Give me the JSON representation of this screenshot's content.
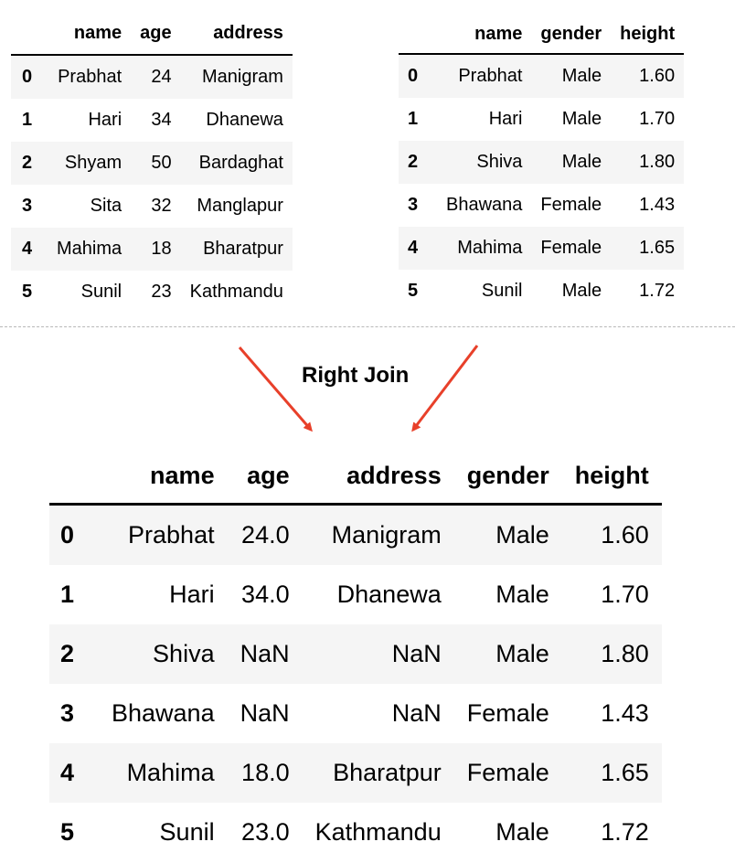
{
  "left_table": {
    "columns": [
      "",
      "name",
      "age",
      "address"
    ],
    "rows": [
      [
        "0",
        "Prabhat",
        "24",
        "Manigram"
      ],
      [
        "1",
        "Hari",
        "34",
        "Dhanewa"
      ],
      [
        "2",
        "Shyam",
        "50",
        "Bardaghat"
      ],
      [
        "3",
        "Sita",
        "32",
        "Manglapur"
      ],
      [
        "4",
        "Mahima",
        "18",
        "Bharatpur"
      ],
      [
        "5",
        "Sunil",
        "23",
        "Kathmandu"
      ]
    ]
  },
  "right_table": {
    "columns": [
      "",
      "name",
      "gender",
      "height"
    ],
    "rows": [
      [
        "0",
        "Prabhat",
        "Male",
        "1.60"
      ],
      [
        "1",
        "Hari",
        "Male",
        "1.70"
      ],
      [
        "2",
        "Shiva",
        "Male",
        "1.80"
      ],
      [
        "3",
        "Bhawana",
        "Female",
        "1.43"
      ],
      [
        "4",
        "Mahima",
        "Female",
        "1.65"
      ],
      [
        "5",
        "Sunil",
        "Male",
        "1.72"
      ]
    ]
  },
  "join_label": "Right Join",
  "arrow_color": "#e8402a",
  "result_table": {
    "columns": [
      "",
      "name",
      "age",
      "address",
      "gender",
      "height"
    ],
    "rows": [
      [
        "0",
        "Prabhat",
        "24.0",
        "Manigram",
        "Male",
        "1.60"
      ],
      [
        "1",
        "Hari",
        "34.0",
        "Dhanewa",
        "Male",
        "1.70"
      ],
      [
        "2",
        "Shiva",
        "NaN",
        "NaN",
        "Male",
        "1.80"
      ],
      [
        "3",
        "Bhawana",
        "NaN",
        "NaN",
        "Female",
        "1.43"
      ],
      [
        "4",
        "Mahima",
        "18.0",
        "Bharatpur",
        "Female",
        "1.65"
      ],
      [
        "5",
        "Sunil",
        "23.0",
        "Kathmandu",
        "Male",
        "1.72"
      ]
    ]
  }
}
